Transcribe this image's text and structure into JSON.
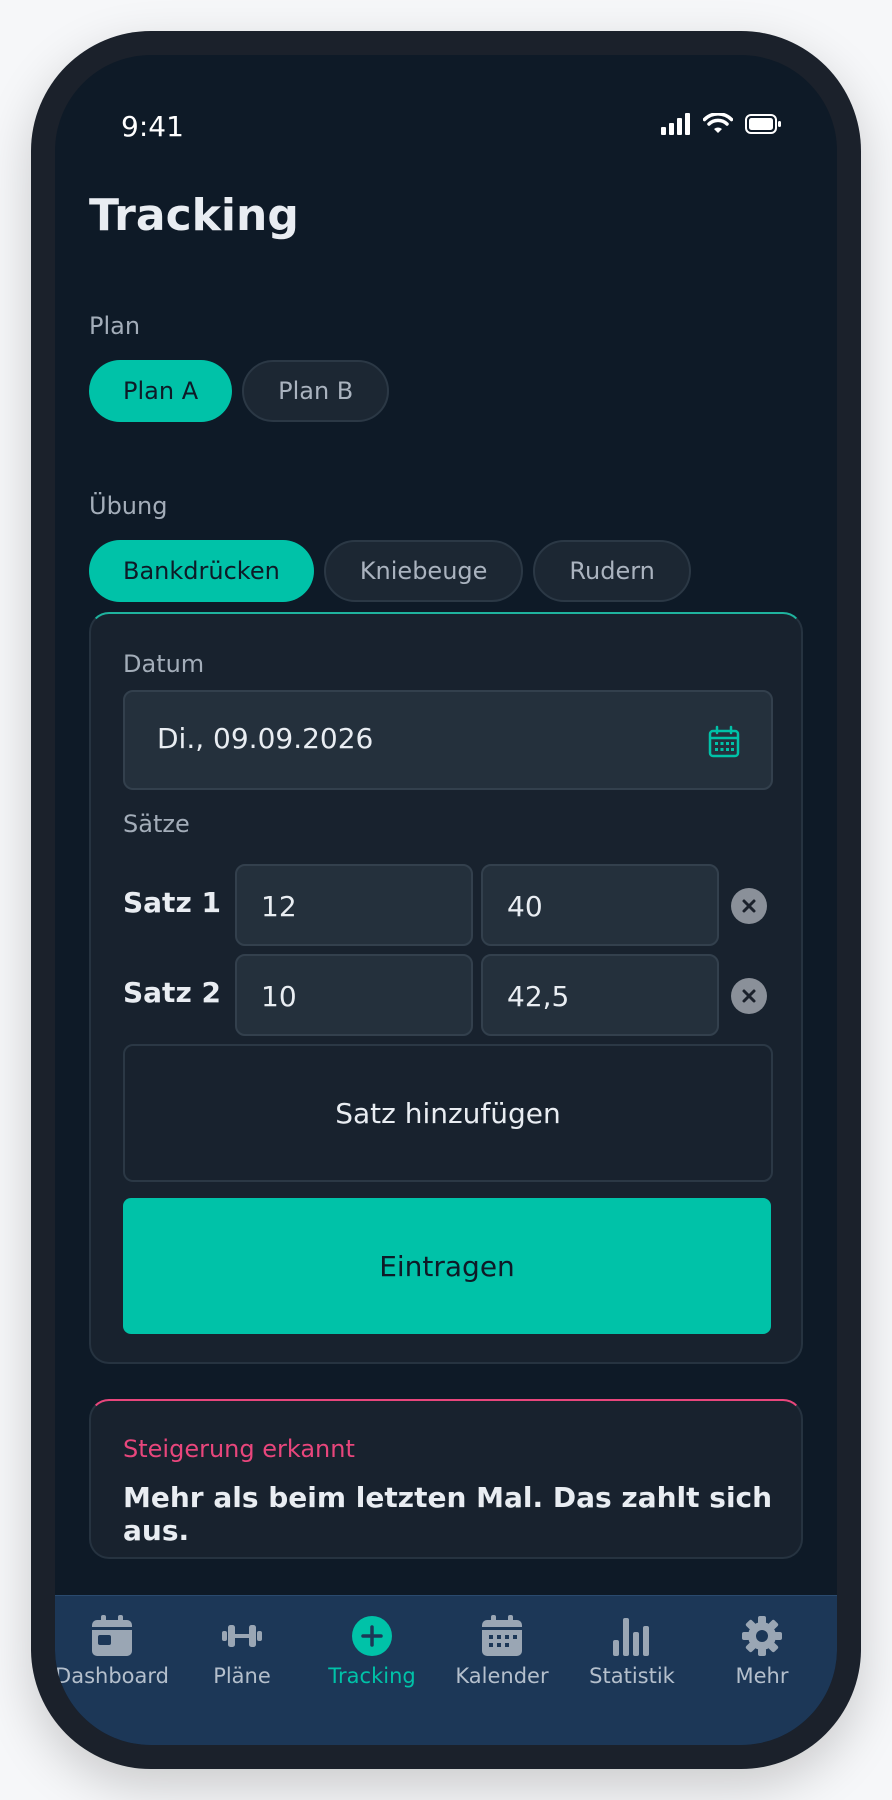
{
  "status_bar": {
    "time": "9:41"
  },
  "page": {
    "title": "Tracking"
  },
  "plan": {
    "label": "Plan",
    "options": [
      "Plan A",
      "Plan B"
    ],
    "selected": "Plan A"
  },
  "exercise": {
    "label": "Übung",
    "options": [
      "Bankdrücken",
      "Kniebeuge",
      "Rudern"
    ],
    "selected": "Bankdrücken"
  },
  "entry_form": {
    "date_label": "Datum",
    "date_value": "Di., 09.09.2026",
    "sets_label": "Sätze",
    "sets": [
      {
        "label": "Satz 1",
        "reps": "12",
        "weight": "40"
      },
      {
        "label": "Satz 2",
        "reps": "10",
        "weight": "42,5"
      }
    ],
    "add_set_label": "Satz hinzufügen",
    "submit_label": "Eintragen"
  },
  "notice": {
    "title": "Steigerung erkannt",
    "text": "Mehr als beim letzten Mal. Das zahlt sich aus."
  },
  "tabbar": {
    "items": [
      {
        "label": "Dashboard",
        "icon": "dashboard-icon"
      },
      {
        "label": "Pläne",
        "icon": "dumbbell-icon"
      },
      {
        "label": "Tracking",
        "icon": "plus-circle-icon"
      },
      {
        "label": "Kalender",
        "icon": "calendar-icon"
      },
      {
        "label": "Statistik",
        "icon": "bar-chart-icon"
      },
      {
        "label": "Mehr",
        "icon": "gear-icon"
      }
    ],
    "active": "Tracking"
  },
  "colors": {
    "accent": "#00c2a8",
    "warning_accent": "#e8467c",
    "background": "#0e1a27",
    "tabbar": "#1c3757"
  }
}
